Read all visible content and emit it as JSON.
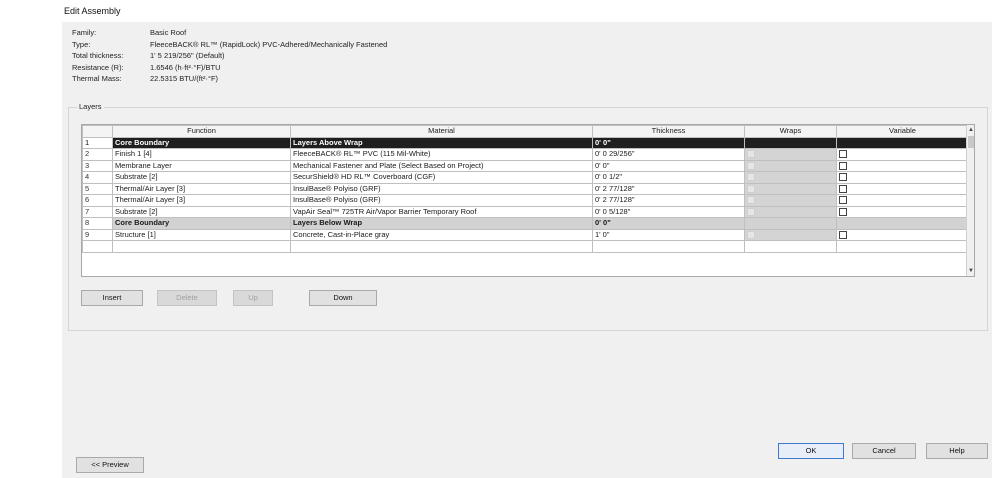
{
  "window": {
    "title": "Edit Assembly"
  },
  "properties": [
    {
      "label": "Family:",
      "value": "Basic Roof"
    },
    {
      "label": "Type:",
      "value": "FleeceBACK® RL™ (RapidLock) PVC-Adhered/Mechanically Fastened"
    },
    {
      "label": "Total thickness:",
      "value": "1' 5 219/256\" (Default)"
    },
    {
      "label": "Resistance (R):",
      "value": "1.6546 (h·ft²·°F)/BTU"
    },
    {
      "label": "Thermal Mass:",
      "value": "22.5315 BTU/(ft²·°F)"
    }
  ],
  "layers": {
    "legend": "Layers",
    "columns": [
      "",
      "Function",
      "Material",
      "Thickness",
      "Wraps",
      "Variable"
    ],
    "rows": [
      {
        "num": "1",
        "function": "Core Boundary",
        "material": "Layers Above Wrap",
        "thickness": "0' 0\""
      },
      {
        "num": "2",
        "function": "Finish 1 [4]",
        "material": "FleeceBACK® RL™ PVC (115 Mil-White)",
        "thickness": "0' 0 29/256\""
      },
      {
        "num": "3",
        "function": "Membrane Layer",
        "material": "Mechanical Fastener and Plate (Select Based on Project)",
        "thickness": "0' 0\""
      },
      {
        "num": "4",
        "function": "Substrate [2]",
        "material": "SecurShield® HD RL™ Coverboard (CGF)",
        "thickness": "0' 0 1/2\""
      },
      {
        "num": "5",
        "function": "Thermal/Air Layer [3]",
        "material": "InsulBase® Polyiso (GRF)",
        "thickness": "0' 2 77/128\""
      },
      {
        "num": "6",
        "function": "Thermal/Air Layer [3]",
        "material": "InsulBase® Polyiso (GRF)",
        "thickness": "0' 2 77/128\""
      },
      {
        "num": "7",
        "function": "Substrate [2]",
        "material": "VapAir Seal™ 725TR Air/Vapor Barrier Temporary Roof",
        "thickness": "0' 0 5/128\""
      },
      {
        "num": "8",
        "function": "Core Boundary",
        "material": "Layers Below Wrap",
        "thickness": "0' 0\""
      },
      {
        "num": "9",
        "function": "Structure [1]",
        "material": "Concrete, Cast-in-Place gray",
        "thickness": "1' 0\""
      }
    ]
  },
  "buttons": {
    "insert": "Insert",
    "delete": "Delete",
    "up": "Up",
    "down": "Down",
    "ok": "OK",
    "cancel": "Cancel",
    "help": "Help",
    "preview": "<< Preview"
  },
  "icons": {
    "scroll_up": "chevron-up-icon",
    "scroll_down": "chevron-down-icon"
  }
}
